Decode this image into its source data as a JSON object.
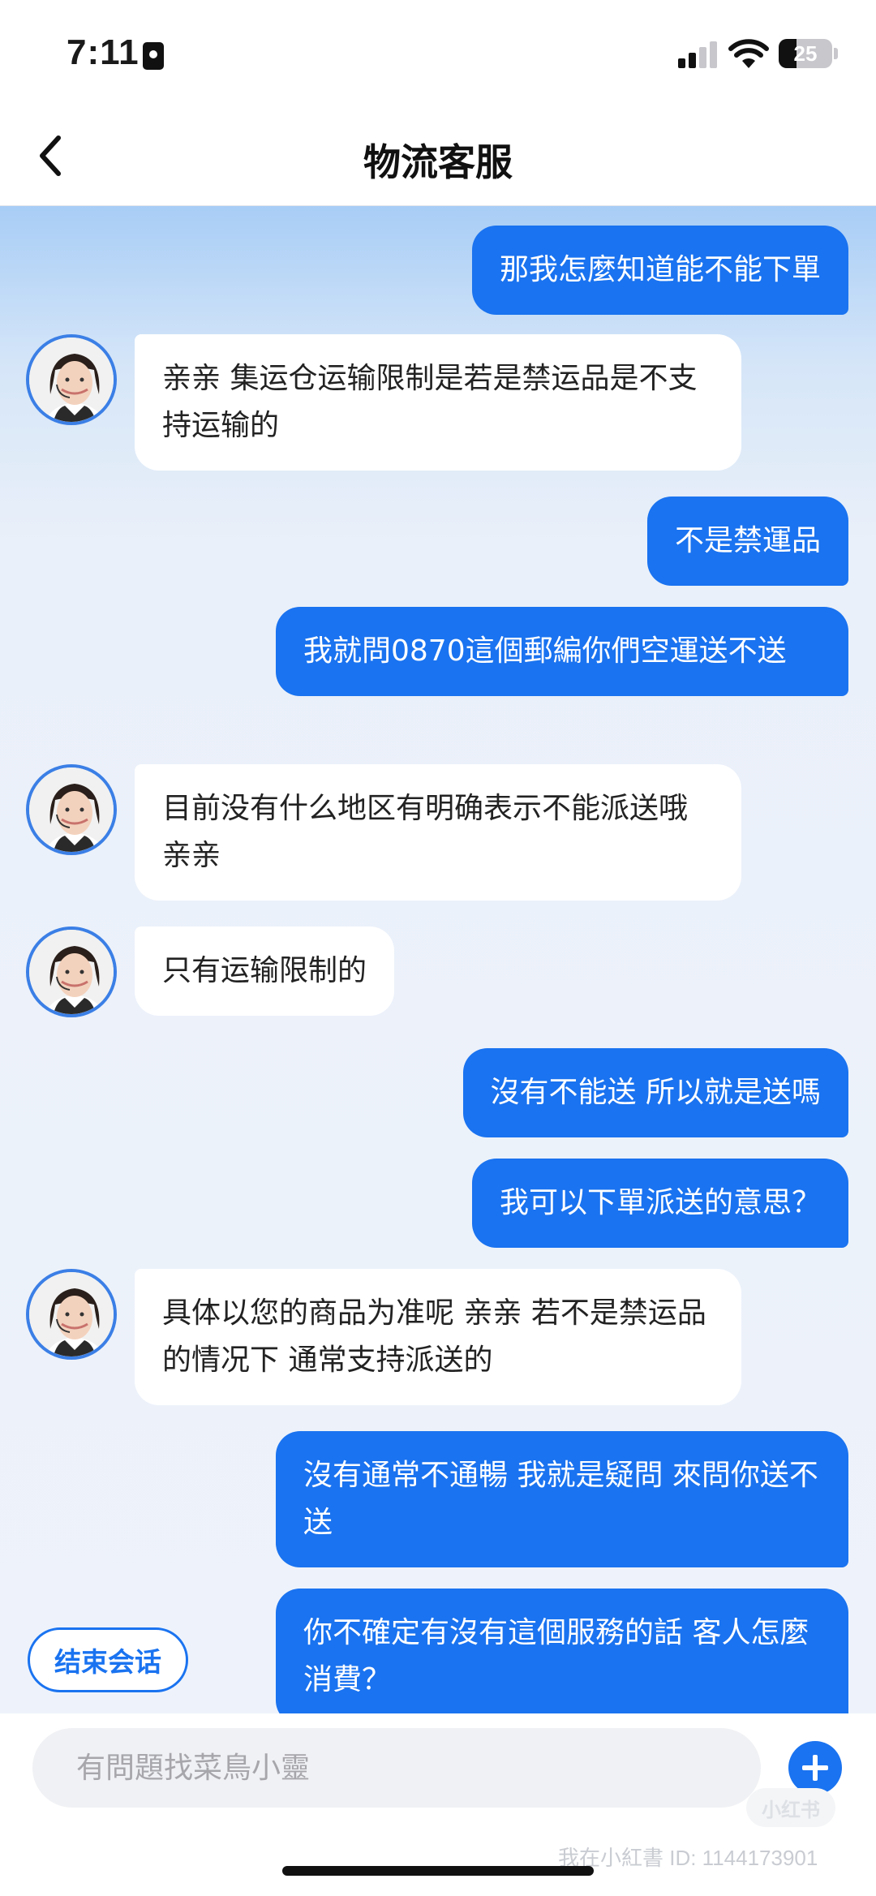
{
  "status": {
    "time": "7:11",
    "battery": "25"
  },
  "nav": {
    "title": "物流客服"
  },
  "messages": [
    {
      "side": "out",
      "text": "那我怎麼知道能不能下單"
    },
    {
      "side": "in",
      "text": "亲亲 集运仓运输限制是若是禁运品是不支持运输的"
    },
    {
      "side": "out",
      "text": "不是禁運品"
    },
    {
      "side": "out",
      "text": "我就問0870這個郵編你們空運送不送"
    },
    {
      "side": "in",
      "text": "目前没有什么地区有明确表示不能派送哦 亲亲"
    },
    {
      "side": "in",
      "text": "只有运输限制的"
    },
    {
      "side": "out",
      "text": "沒有不能送 所以就是送嗎"
    },
    {
      "side": "out",
      "text": "我可以下單派送的意思？"
    },
    {
      "side": "in",
      "text": "具体以您的商品为准呢 亲亲 若不是禁运品的情况下 通常支持派送的"
    },
    {
      "side": "out",
      "text": "沒有通常不通暢 我就是疑問 來問你送不送"
    },
    {
      "side": "out",
      "text": "你不確定有沒有這個服務的話 客人怎麼消費？"
    }
  ],
  "end_button": "结束会话",
  "input": {
    "placeholder": "有問題找菜鳥小靈"
  },
  "watermark": {
    "logo": "小红书",
    "text": "我在小紅書 ID: 1144173901"
  },
  "colors": {
    "accent": "#1a73f0",
    "bubble_in": "#ffffff",
    "background": "#eef3fb"
  },
  "icons": [
    "back-chevron-icon",
    "signal-icon",
    "wifi-icon",
    "battery-icon",
    "agent-avatar-icon",
    "plus-icon"
  ]
}
